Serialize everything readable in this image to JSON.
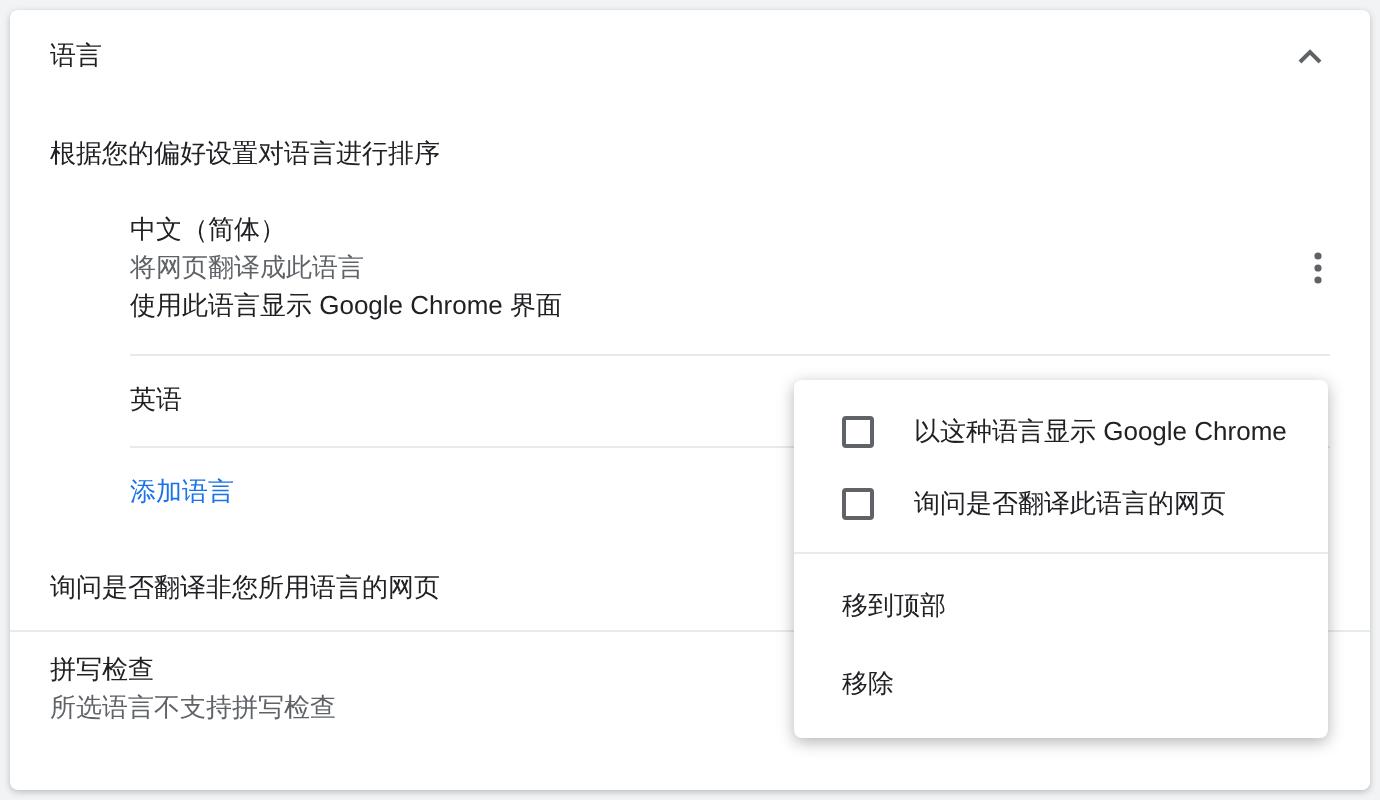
{
  "section": {
    "title": "语言",
    "expanded": true
  },
  "order_label": "根据您的偏好设置对语言进行排序",
  "languages": [
    {
      "name": "中文（简体）",
      "details": [
        "将网页翻译成此语言",
        "使用此语言显示 Google Chrome 界面"
      ]
    },
    {
      "name": "英语"
    }
  ],
  "add_language": "添加语言",
  "translate_offer": "询问是否翻译非您所用语言的网页",
  "spell_check": {
    "title": "拼写检查",
    "subtitle": "所选语言不支持拼写检查"
  },
  "menu": {
    "items": [
      {
        "kind": "checkbox",
        "label": "以这种语言显示 Google Chrome",
        "checked": false
      },
      {
        "kind": "checkbox",
        "label": "询问是否翻译此语言的网页",
        "checked": false
      },
      {
        "kind": "action",
        "label": "移到顶部"
      },
      {
        "kind": "action",
        "label": "移除"
      }
    ]
  }
}
